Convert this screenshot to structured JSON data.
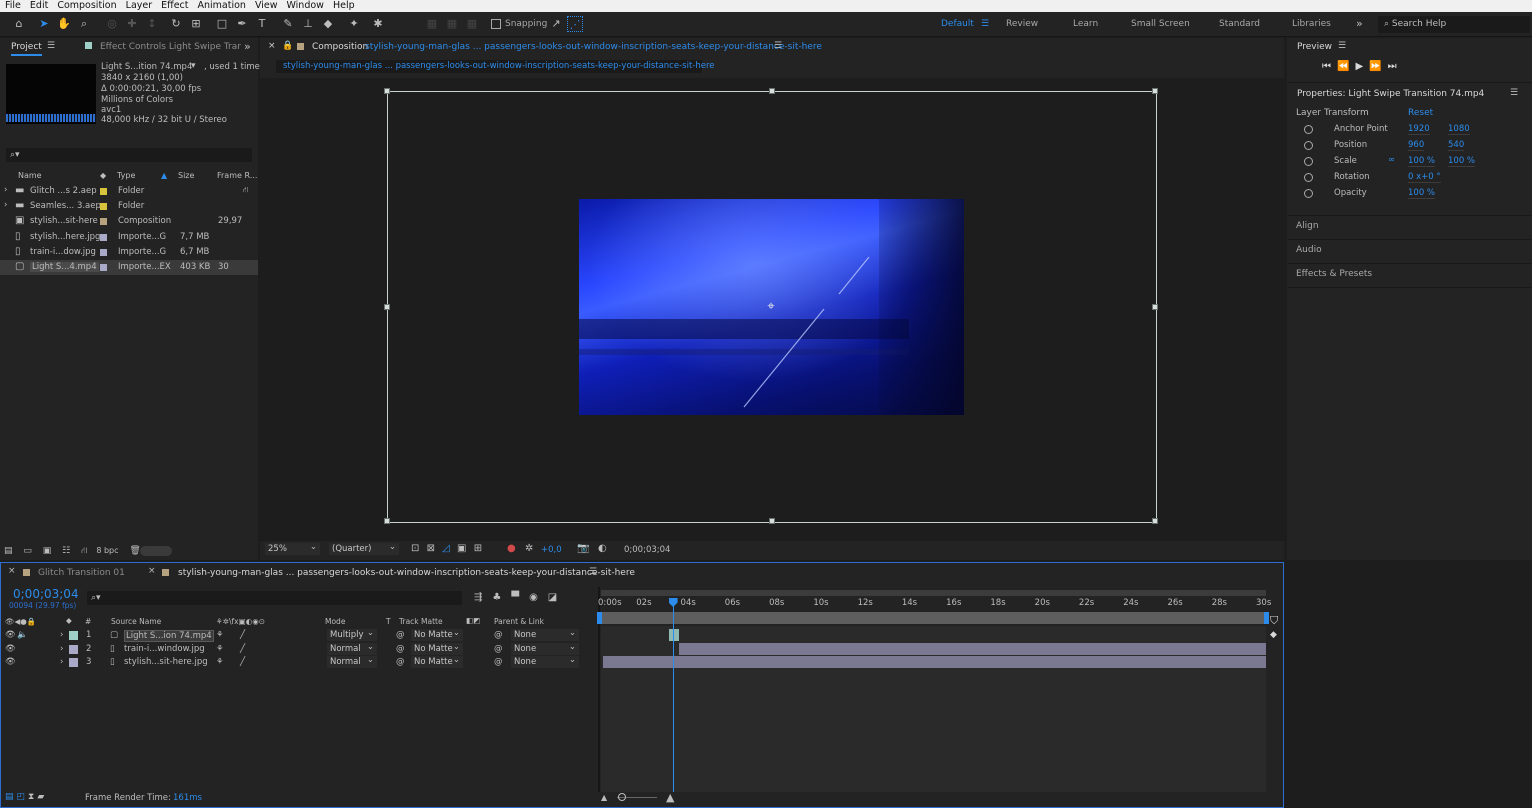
{
  "menu": [
    "File",
    "Edit",
    "Composition",
    "Layer",
    "Effect",
    "Animation",
    "View",
    "Window",
    "Help"
  ],
  "toolbar": {
    "snapping_label": "Snapping",
    "workspaces": [
      {
        "label": "Default",
        "active": true
      },
      {
        "label": "Review",
        "active": false
      },
      {
        "label": "Learn",
        "active": false
      },
      {
        "label": "Small Screen",
        "active": false
      },
      {
        "label": "Standard",
        "active": false
      },
      {
        "label": "Libraries",
        "active": false
      }
    ],
    "search_help": "Search Help"
  },
  "project_panel": {
    "tab_project": "Project",
    "tab_effect_controls": "Effect Controls Light Swipe Trar",
    "info": {
      "name": "Light S...ition 74.mp4",
      "used": ", used 1 time",
      "resolution": "3840 x 2160 (1,00)",
      "duration": "Δ 0:00:00:21, 30,00 fps",
      "colors": "Millions of Colors",
      "codec": "avc1",
      "audio": "48,000 kHz / 32 bit U / Stereo"
    },
    "search_placeholder": "⌕▾",
    "columns": {
      "name": "Name",
      "type": "Type",
      "size": "Size",
      "frame_rate": "Frame R..."
    },
    "items": [
      {
        "name": "Glitch ...s 2.aep",
        "type": "Folder",
        "size": "",
        "fps": "",
        "label_color": "#d8c33c",
        "icon": "folder-icon"
      },
      {
        "name": "Seamles... 3.aep",
        "type": "Folder",
        "size": "",
        "fps": "",
        "label_color": "#d8c33c",
        "icon": "folder-icon"
      },
      {
        "name": "stylish...sit-here",
        "type": "Composition",
        "size": "",
        "fps": "29,97",
        "label_color": "#b7a27f",
        "icon": "composition-icon"
      },
      {
        "name": "stylish...here.jpg",
        "type": "Importe...G",
        "size": "7,7 MB",
        "fps": "",
        "label_color": "#a9a9c8",
        "icon": "image-file-icon"
      },
      {
        "name": "train-i...dow.jpg",
        "type": "Importe...G",
        "size": "6,7 MB",
        "fps": "",
        "label_color": "#a9a9c8",
        "icon": "image-file-icon"
      },
      {
        "name": "Light S...4.mp4",
        "type": "Importe...EX",
        "size": "403 KB",
        "fps": "30",
        "label_color": "#a9a9c8",
        "icon": "video-file-icon"
      }
    ],
    "bpc": "8 bpc"
  },
  "composition_panel": {
    "tab_prefix": "Composition",
    "tab_name": "stylish-young-man-glas ... passengers-looks-out-window-inscription-seats-keep-your-distance-sit-here",
    "subtab": "stylish-young-man-glas ... passengers-looks-out-window-inscription-seats-keep-your-distance-sit-here",
    "zoom": "25%",
    "resolution": "(Quarter)",
    "exposure": "+0,0",
    "timecode": "0;00;03;04"
  },
  "timeline": {
    "tab_inactive": "Glitch Transition 01",
    "tab_active": "stylish-young-man-glas ... passengers-looks-out-window-inscription-seats-keep-your-distance-sit-here",
    "current_time": "0;00;03;04",
    "frame_info": "00094 (29.97 fps)",
    "headers": {
      "num": "#",
      "source": "Source Name",
      "mode": "Mode",
      "t": "T",
      "matte": "Track Matte",
      "parent": "Parent & Link"
    },
    "layers": [
      {
        "num": "1",
        "name": "Light S...ion 74.mp4",
        "mode": "Multiply",
        "matte": "No Matte",
        "parent": "None",
        "label_color": "#9fd0c8",
        "icon": "video-file-icon",
        "start": 0.1,
        "end": 0.115
      },
      {
        "num": "2",
        "name": "train-i...window.jpg",
        "mode": "Normal",
        "matte": "No Matte",
        "parent": "None",
        "label_color": "#a9a9c8",
        "icon": "image-file-icon",
        "start": 0.115,
        "end": 1.0
      },
      {
        "num": "3",
        "name": "stylish...sit-here.jpg",
        "mode": "Normal",
        "matte": "No Matte",
        "parent": "None",
        "label_color": "#a9a9c8",
        "icon": "image-file-icon",
        "start": 0.0,
        "end": 1.0
      }
    ],
    "ruler": [
      "0:00s",
      "02s",
      "04s",
      "06s",
      "08s",
      "10s",
      "12s",
      "14s",
      "16s",
      "18s",
      "20s",
      "22s",
      "24s",
      "26s",
      "28s",
      "30s"
    ],
    "playhead": 0.105,
    "frame_render_label": "Frame Render Time:",
    "frame_render_value": "161ms"
  },
  "preview_panel": {
    "title": "Preview"
  },
  "properties_panel": {
    "title": "Properties: Light Swipe Transition 74.mp4",
    "section": "Layer Transform",
    "reset": "Reset",
    "rows": [
      {
        "label": "Anchor Point",
        "v1": "1920",
        "v2": "1080"
      },
      {
        "label": "Position",
        "v1": "960",
        "v2": "540"
      },
      {
        "label": "Scale",
        "v1": "100 %",
        "v2": "100 %"
      },
      {
        "label": "Rotation",
        "v1": "0 x+0 °",
        "v2": ""
      },
      {
        "label": "Opacity",
        "v1": "100 %",
        "v2": ""
      }
    ],
    "collapsed_sections": [
      "Align",
      "Audio",
      "Effects & Presets"
    ]
  }
}
